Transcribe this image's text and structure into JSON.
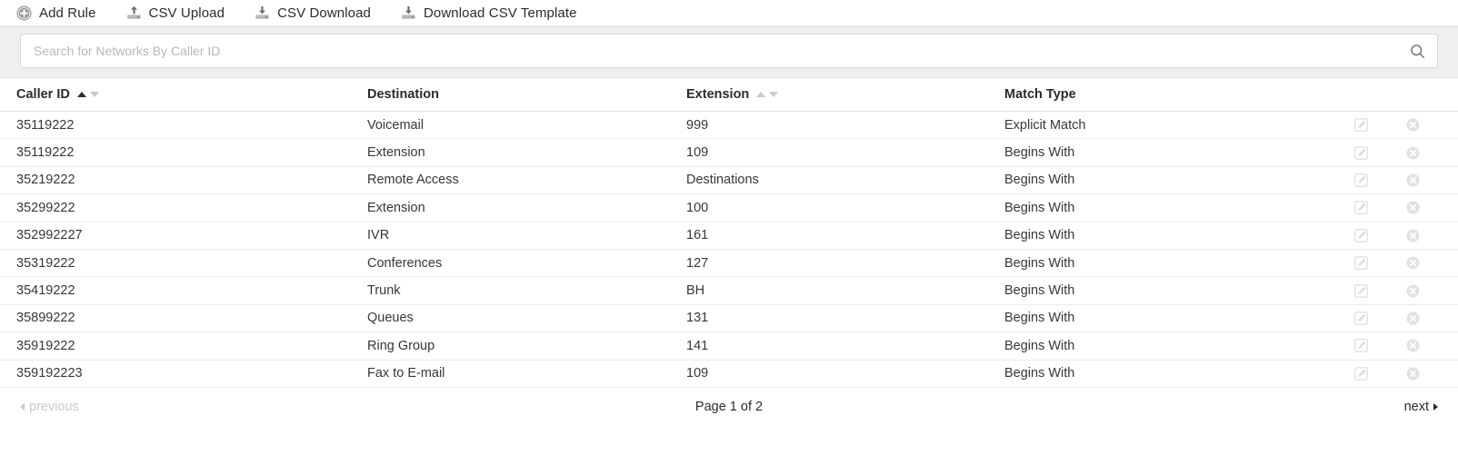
{
  "toolbar": {
    "items": [
      {
        "label": "Add Rule",
        "icon": "plus-circle-icon"
      },
      {
        "label": "CSV Upload",
        "icon": "upload-icon"
      },
      {
        "label": "CSV Download",
        "icon": "download-icon"
      },
      {
        "label": "Download CSV Template",
        "icon": "download-icon"
      }
    ]
  },
  "search": {
    "placeholder": "Search for Networks By Caller ID",
    "value": "",
    "icon": "search-icon"
  },
  "table": {
    "columns": [
      {
        "label": "Caller ID",
        "sortable": true,
        "sort": "asc"
      },
      {
        "label": "Destination",
        "sortable": false,
        "sort": "none"
      },
      {
        "label": "Extension",
        "sortable": true,
        "sort": "none"
      },
      {
        "label": "Match Type",
        "sortable": false,
        "sort": "none"
      }
    ],
    "rows": [
      {
        "caller_id": "35119222",
        "destination": "Voicemail",
        "extension": "999",
        "match_type": "Explicit Match"
      },
      {
        "caller_id": "35119222",
        "destination": "Extension",
        "extension": "109",
        "match_type": "Begins With"
      },
      {
        "caller_id": "35219222",
        "destination": "Remote Access",
        "extension": "Destinations",
        "match_type": "Begins With"
      },
      {
        "caller_id": "35299222",
        "destination": "Extension",
        "extension": "100",
        "match_type": "Begins With"
      },
      {
        "caller_id": "352992227",
        "destination": "IVR",
        "extension": "161",
        "match_type": "Begins With"
      },
      {
        "caller_id": "35319222",
        "destination": "Conferences",
        "extension": "127",
        "match_type": "Begins With"
      },
      {
        "caller_id": "35419222",
        "destination": "Trunk",
        "extension": "BH",
        "match_type": "Begins With"
      },
      {
        "caller_id": "35899222",
        "destination": "Queues",
        "extension": "131",
        "match_type": "Begins With"
      },
      {
        "caller_id": "35919222",
        "destination": "Ring Group",
        "extension": "141",
        "match_type": "Begins With"
      },
      {
        "caller_id": "359192223",
        "destination": "Fax to E-mail",
        "extension": "109",
        "match_type": "Begins With"
      }
    ],
    "row_actions": [
      {
        "name": "edit-icon",
        "label": "Edit"
      },
      {
        "name": "delete-icon",
        "label": "Delete"
      }
    ]
  },
  "pagination": {
    "previous_label": "previous",
    "next_label": "next",
    "page_info": "Page 1 of 2",
    "previous_enabled": false,
    "next_enabled": true
  },
  "colors": {
    "band_background": "#efefef",
    "text": "#2b2b2b",
    "muted": "#c9c9c9",
    "border": "#ececec",
    "icon_grey": "#9a9a9a",
    "action_icon": "#e2e2e2"
  }
}
